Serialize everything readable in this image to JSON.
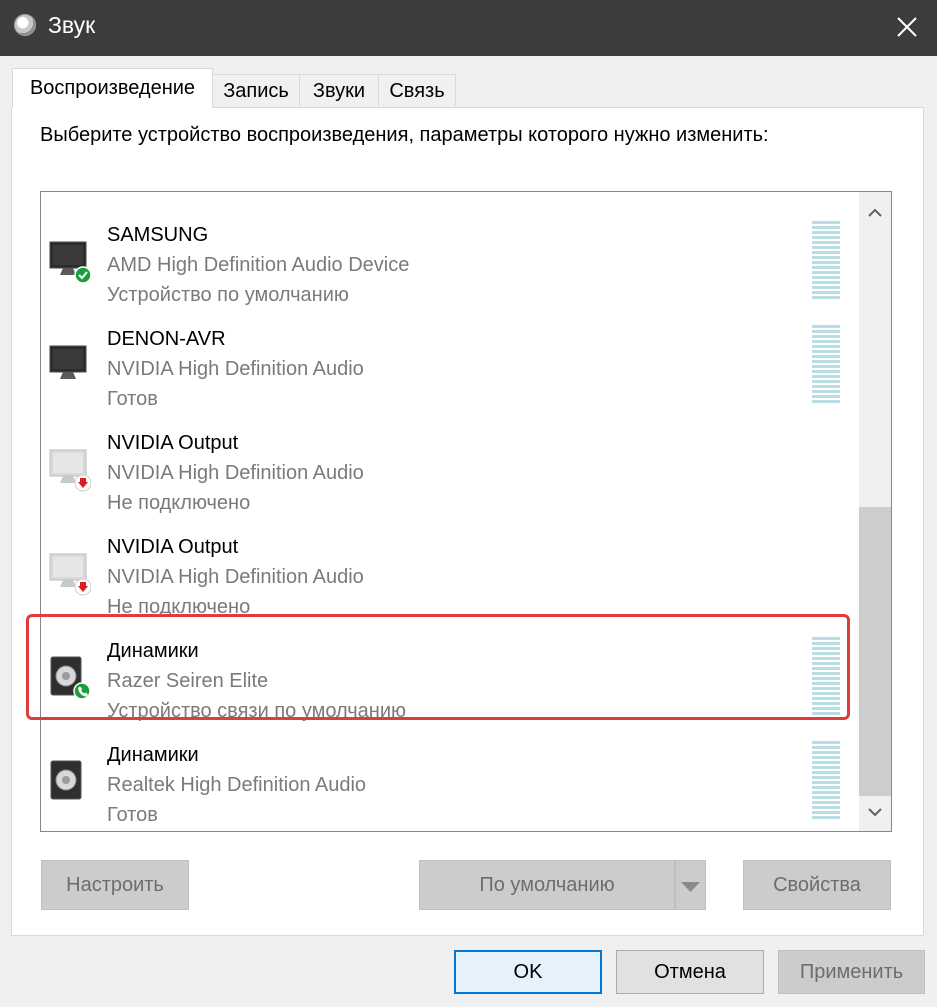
{
  "window": {
    "title": "Звук",
    "icon": "speaker-app-icon",
    "close_icon": "close-icon"
  },
  "tabs": [
    {
      "label": "Воспроизведение",
      "active": true
    },
    {
      "label": "Запись",
      "active": false
    },
    {
      "label": "Звуки",
      "active": false
    },
    {
      "label": "Связь",
      "active": false
    }
  ],
  "instruction": "Выберите устройство воспроизведения, параметры которого нужно изменить:",
  "devices": [
    {
      "name": "SAMSUNG",
      "driver": "AMD High Definition Audio Device",
      "status": "Устройство по умолчанию",
      "icon": "monitor-icon",
      "badge": "default-check-icon",
      "meter": true
    },
    {
      "name": "DENON-AVR",
      "driver": "NVIDIA High Definition Audio",
      "status": "Готов",
      "icon": "monitor-icon",
      "badge": "",
      "meter": true
    },
    {
      "name": "NVIDIA Output",
      "driver": "NVIDIA High Definition Audio",
      "status": "Не подключено",
      "icon": "monitor-disconnected-icon",
      "badge": "disconnected-arrow-icon",
      "meter": false
    },
    {
      "name": "NVIDIA Output",
      "driver": "NVIDIA High Definition Audio",
      "status": "Не подключено",
      "icon": "monitor-disconnected-icon",
      "badge": "disconnected-arrow-icon",
      "meter": false
    },
    {
      "name": "Динамики",
      "driver": "Razer Seiren Elite",
      "status": "Устройство связи по умолчанию",
      "icon": "speaker-icon",
      "badge": "default-communication-phone-icon",
      "meter": true,
      "highlighted": true
    },
    {
      "name": "Динамики",
      "driver": "Realtek High Definition Audio",
      "status": "Готов",
      "icon": "speaker-icon",
      "badge": "",
      "meter": true
    }
  ],
  "buttons": {
    "configure": "Настроить",
    "set_default": "По умолчанию",
    "properties": "Свойства",
    "ok": "OK",
    "cancel": "Отмена",
    "apply": "Применить"
  },
  "colors": {
    "titlebar": "#3c3c3c",
    "highlight_border": "#e03c3c",
    "default_badge": "#1e9e3a",
    "disconnected_badge": "#d91f1f",
    "level_meter": "#b9dde4",
    "ok_border": "#0078d7"
  }
}
